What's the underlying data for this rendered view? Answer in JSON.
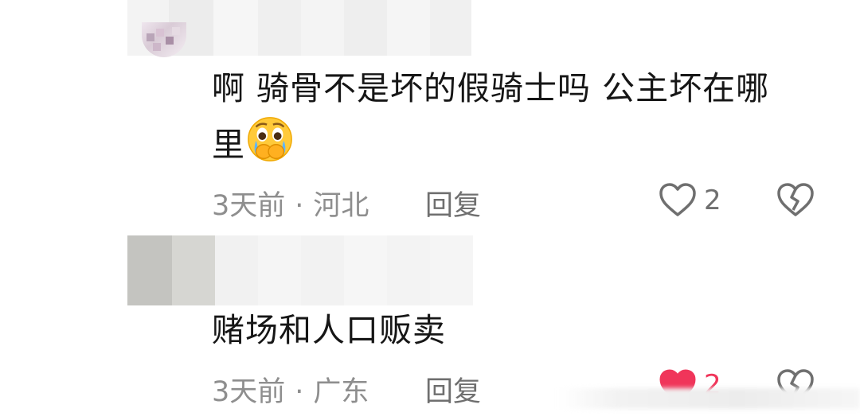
{
  "comments": [
    {
      "text_line1": "啊 骑骨不是坏的假骑士吗 公主坏在哪",
      "text_line2": "里",
      "emoji": "crying-face-emoji",
      "time": "3天前",
      "separator": "·",
      "location": "河北",
      "reply_label": "回复",
      "likes": "2",
      "liked": false
    },
    {
      "text_line1": "赌场和人口贩卖",
      "time": "3天前",
      "separator": "·",
      "location": "广东",
      "reply_label": "回复",
      "likes": "2",
      "liked": true
    }
  ],
  "colors": {
    "text": "#161616",
    "meta": "#8e8e8e",
    "like_active": "#f0355a",
    "icon": "#6f6f6f"
  }
}
